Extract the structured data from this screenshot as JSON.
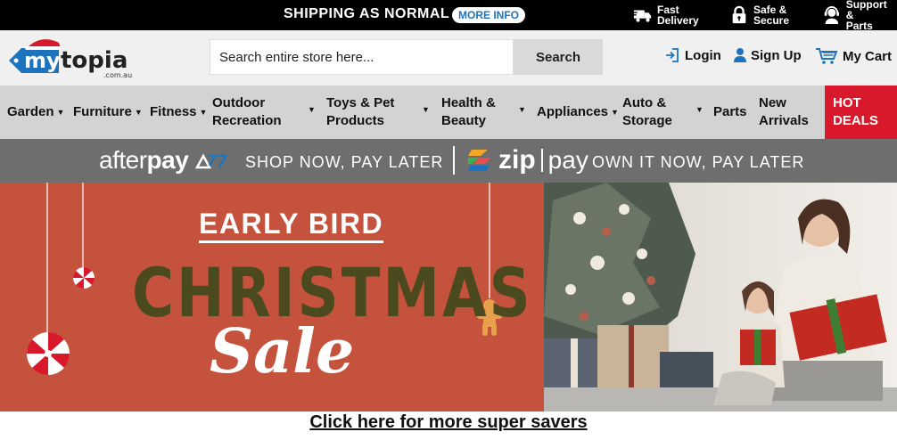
{
  "topbar": {
    "shipping_text": "SHIPPING AS NORMAL",
    "more_info_label": "MORE INFO",
    "features": [
      {
        "icon": "truck-icon",
        "label": "Fast\nDelivery"
      },
      {
        "icon": "lock-icon",
        "label": "Safe &\nSecure"
      },
      {
        "icon": "headset-icon",
        "label": "Support &\nParts"
      }
    ]
  },
  "header": {
    "logo_text": "mytopia",
    "logo_sub": ".com.au",
    "search_placeholder": "Search entire store here...",
    "search_button": "Search",
    "login_label": "Login",
    "signup_label": "Sign Up",
    "cart_label": "My Cart"
  },
  "nav": {
    "items": [
      {
        "label": "Garden"
      },
      {
        "label": "Furniture"
      },
      {
        "label": "Fitness"
      },
      {
        "label": "Outdoor Recreation"
      },
      {
        "label": "Toys & Pet Products"
      },
      {
        "label": "Health & Beauty"
      },
      {
        "label": "Appliances"
      },
      {
        "label": "Auto & Storage"
      },
      {
        "label": "Parts"
      },
      {
        "label": "New Arrivals"
      },
      {
        "label": "HOT DEALS"
      }
    ]
  },
  "paybar": {
    "afterpay_logo_a": "after",
    "afterpay_logo_b": "pay",
    "afterpay_text": "SHOP NOW, PAY LATER",
    "zip_word": "zip",
    "pay_word": "pay",
    "zip_text": "OWN IT NOW, PAY LATER"
  },
  "banner": {
    "line1": "EARLY BIRD",
    "line2": "CHRISTMAS",
    "line3": "Sale"
  },
  "cta": {
    "label": "Click here for more super savers"
  },
  "colors": {
    "topbar_bg": "#000000",
    "header_bg": "#f0f0f0",
    "nav_bg": "#d3d3d3",
    "hot_deals_bg": "#d7192b",
    "paybar_bg": "#6e6e6e",
    "banner_bg": "#c5523c",
    "christmas_text": "#4a4a1e",
    "logo_blue": "#1e73be",
    "logo_red": "#d7192b"
  }
}
